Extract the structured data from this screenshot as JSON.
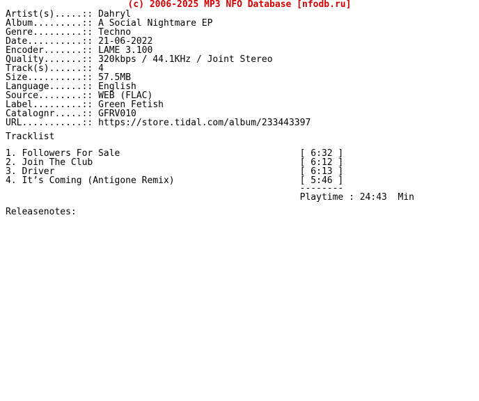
{
  "banner": {
    "text": "(c) 2006-2025 MP3 NFO Database [nfodb.ru]",
    "color": "#d40000"
  },
  "colors": {
    "background": "#ffffff",
    "text": "#000000",
    "accent": "#d40000"
  },
  "metadata": {
    "rows": [
      {
        "label": "Artist(s)",
        "leader": ".....::",
        "value": "Dahryl"
      },
      {
        "label": "Album",
        "leader": ".........::",
        "value": "A Social Nightmare EP"
      },
      {
        "label": "Genre",
        "leader": "........::",
        "value": "Techno"
      },
      {
        "label": "Date",
        "leader": "..........::",
        "value": "21-06-2022"
      },
      {
        "label": "Encoder",
        "leader": ".......::",
        "value": "LAME 3.100"
      },
      {
        "label": "Quality",
        "leader": ".......::",
        "value": "320kbps / 44.1KHz / Joint Stereo"
      },
      {
        "label": "Track(s)",
        "leader": "......::",
        "value": "4"
      },
      {
        "label": "Size",
        "leader": "..........::",
        "value": "57.5MB"
      },
      {
        "label": "Language",
        "leader": "......::",
        "value": "English"
      },
      {
        "label": "Source",
        "leader": "........::",
        "value": "WEB (FLAC)"
      },
      {
        "label": "Label",
        "leader": ".........::",
        "value": "Green Fetish"
      },
      {
        "label": "Catalognr",
        "leader": ".....::",
        "value": "GFRV010"
      },
      {
        "label": "URL",
        "leader": "...........::",
        "value": "https://store.tidal.com/album/233443397"
      }
    ],
    "label_field_width": 14,
    "value_column": 17
  },
  "tracklist": {
    "heading": "Tracklist",
    "duration_column": 54,
    "tracks": [
      {
        "number": "1.",
        "title": "Followers For Sale",
        "duration": "[ 6:32 ]"
      },
      {
        "number": "2.",
        "title": "Join The Club",
        "duration": "[ 6:12 ]"
      },
      {
        "number": "3.",
        "title": "Driver",
        "duration": "[ 6:13 ]"
      },
      {
        "number": "4.",
        "title": "It’s Coming (Antigone Remix)",
        "duration": "[ 5:46 ]"
      }
    ],
    "separator": "--------",
    "playtime_label": "Playtime :",
    "playtime_value": "24:43",
    "playtime_unit": "Min"
  },
  "releasenotes": {
    "heading": "Releasenotes:",
    "body": ""
  }
}
